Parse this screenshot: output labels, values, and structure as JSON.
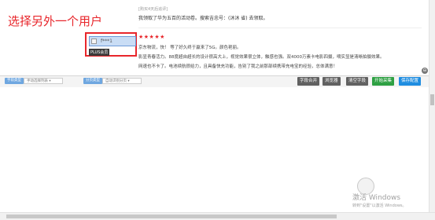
{
  "annotation": "选择另外一个用户",
  "review_above": {
    "header": "[购买4天后追评]",
    "text": "我领取了华为五百的活动卷。搜索吉忠号：(沐沐 省) 去领取。"
  },
  "reviewer": {
    "name": "f***1",
    "badge": "PLUS会员"
  },
  "review": {
    "stars": "★★★★★",
    "lines": [
      "京东物流，快！ 等了好久终于赢来了5G。颜色艳丽。",
      "影显青春活力。88度超自超长的设计很高大上，视觉效果很立体，触感也强。双4000万素卡电影四摄，嘀实显是清晰拍摄效果。",
      "网速也不卡了。电池续航很给力，且具备快充功能，告别了我之前那部续携带充电宝的经验，总体满意！"
    ]
  },
  "toolbar": {
    "field_type_label": "字段类型",
    "field_type_value": "手动选择列表 ▾",
    "paging_type_label": "分页类型",
    "paging_type_value": "自动识别分页 ▾",
    "buttons": [
      "字段合并",
      "浏览器",
      "清空字段",
      "开始采集",
      "保存配置"
    ]
  },
  "watermark": {
    "line1": "激活 Windows",
    "line2": "转到\"设置\"以激活 Windows。"
  },
  "colors": {
    "annotation_red": "#e8262b",
    "start_green": "#2ea043",
    "save_blue": "#1f8de0",
    "label_blue": "#6fa7e0"
  }
}
